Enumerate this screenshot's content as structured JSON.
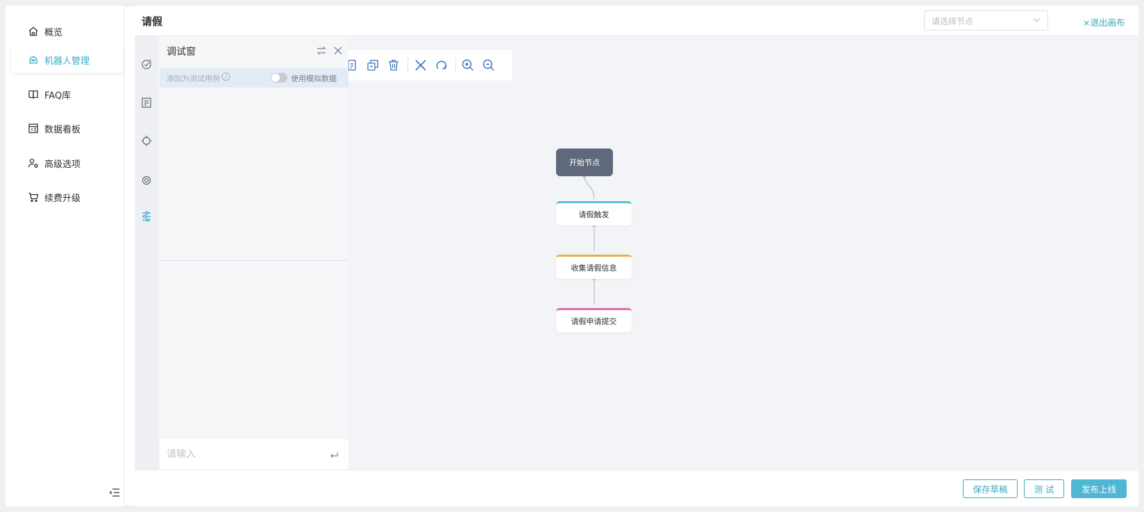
{
  "sidebar": {
    "items": [
      {
        "label": "概览",
        "icon": "home-icon"
      },
      {
        "label": "机器人管理",
        "icon": "robot-icon",
        "active": true
      },
      {
        "label": "FAQ库",
        "icon": "book-icon"
      },
      {
        "label": "数据看板",
        "icon": "dashboard-icon"
      },
      {
        "label": "高级选项",
        "icon": "users-gear-icon"
      },
      {
        "label": "续费升级",
        "icon": "cart-icon"
      }
    ]
  },
  "header": {
    "title": "请假",
    "node_select_placeholder": "请选择节点",
    "exit_label": "×退出画布"
  },
  "debug": {
    "title": "调试窗",
    "add_case_label": "添加为测试用例",
    "mock_label": "使用模拟数据",
    "mock_enabled": false,
    "input_placeholder": "请输入"
  },
  "flow": {
    "start_label": "开始节点",
    "nodes": [
      {
        "label": "请假触发",
        "color": "#5bc0cf"
      },
      {
        "label": "收集请假信息",
        "color": "#e8b04b"
      },
      {
        "label": "请假申请提交",
        "color": "#e26aa6"
      }
    ]
  },
  "footer": {
    "save_draft": "保存草稿",
    "test": "测 试",
    "publish": "发布上线"
  },
  "colors": {
    "accent": "#39a9c6",
    "primary_button": "#4fb6d3",
    "start_node": "#60697b"
  }
}
